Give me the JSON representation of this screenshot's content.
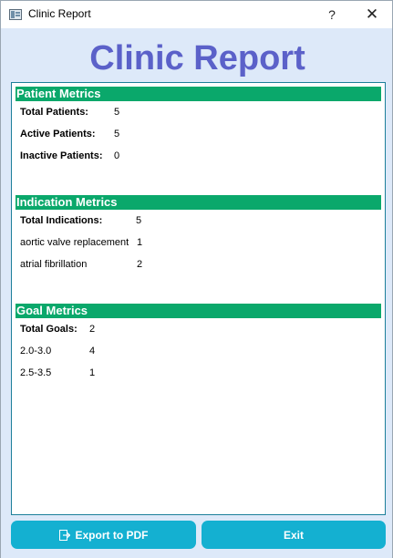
{
  "window": {
    "title": "Clinic Report",
    "help_glyph": "?",
    "close_glyph": "✕"
  },
  "report_title": "Clinic Report",
  "patient_metrics": {
    "header": "Patient Metrics",
    "rows": [
      {
        "label": "Total Patients:",
        "value": "5"
      },
      {
        "label": "Active Patients:",
        "value": "5"
      },
      {
        "label": "Inactive Patients:",
        "value": "0"
      }
    ]
  },
  "indication_metrics": {
    "header": "Indication Metrics",
    "rows": [
      {
        "label": "Total Indications:",
        "value": "5"
      },
      {
        "label": "aortic valve replacement",
        "value": "1"
      },
      {
        "label": "atrial fibrillation",
        "value": "2"
      }
    ]
  },
  "goal_metrics": {
    "header": "Goal Metrics",
    "rows": [
      {
        "label": "Total Goals:",
        "value": "2"
      },
      {
        "label": "2.0-3.0",
        "value": "4"
      },
      {
        "label": "2.5-3.5",
        "value": "1"
      }
    ]
  },
  "buttons": {
    "export_label": "Export to PDF",
    "exit_label": "Exit"
  },
  "colors": {
    "title": "#5b61c9",
    "section_header": "#0aa86b",
    "button": "#14b0d1",
    "background": "#dde9f9"
  },
  "icons": {
    "app": "window-icon",
    "export": "export-icon"
  }
}
